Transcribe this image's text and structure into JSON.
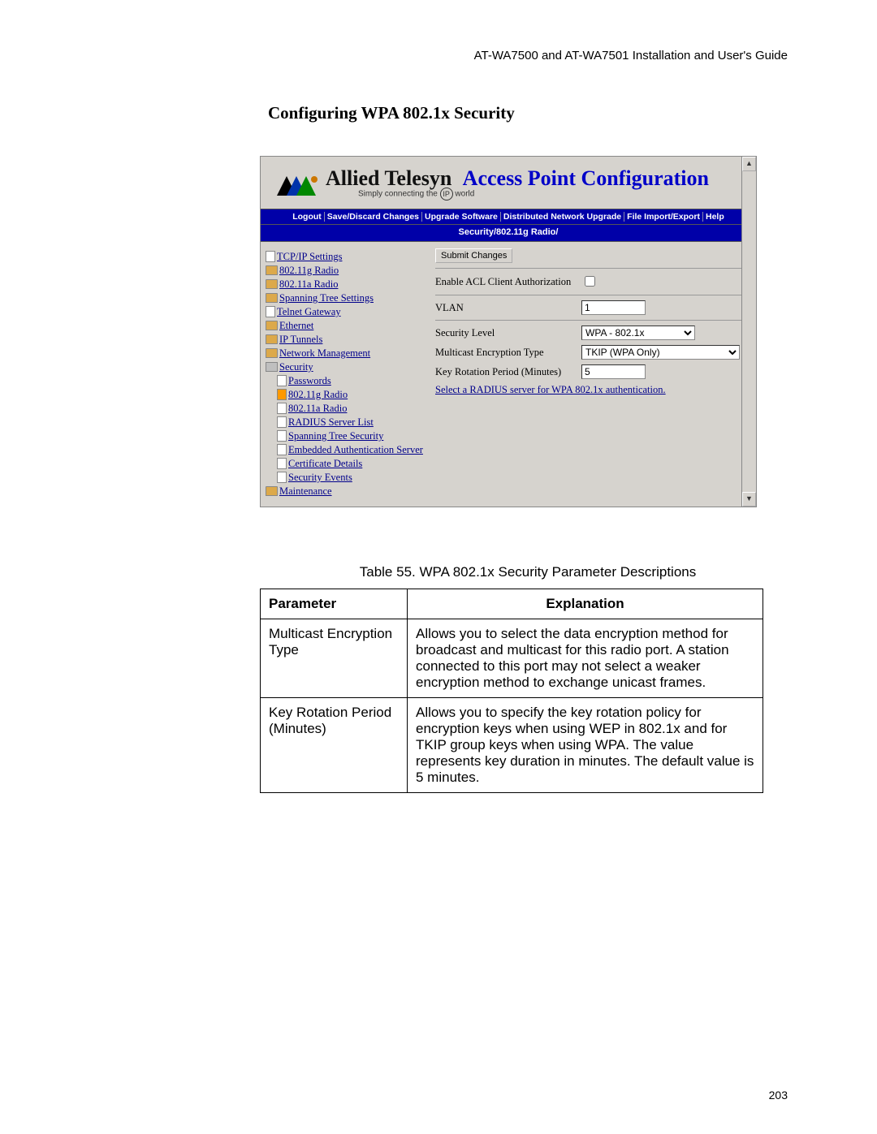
{
  "doc_header": "AT-WA7500 and AT-WA7501 Installation and User's Guide",
  "section_title": "Configuring WPA 802.1x Security",
  "page_number": "203",
  "screenshot": {
    "brand_left": "Allied Telesyn",
    "brand_right": "Access Point Configuration",
    "brand_sub_pre": "Simply connecting the",
    "brand_sub_ip": "IP",
    "brand_sub_post": "world",
    "menu": [
      "Logout",
      "Save/Discard Changes",
      "Upgrade Software",
      "Distributed Network Upgrade",
      "File Import/Export",
      "Help"
    ],
    "breadcrumb": "Security/802.11g Radio/",
    "nav": [
      {
        "icon": "icon-page",
        "label": "TCP/IP Settings",
        "indent": 0
      },
      {
        "icon": "icon-folder",
        "label": "802.11g Radio",
        "indent": 0
      },
      {
        "icon": "icon-folder",
        "label": "802.11a Radio",
        "indent": 0
      },
      {
        "icon": "icon-folder",
        "label": "Spanning Tree Settings",
        "indent": 0
      },
      {
        "icon": "icon-page",
        "label": "Telnet Gateway",
        "indent": 0
      },
      {
        "icon": "icon-folder",
        "label": "Ethernet",
        "indent": 0
      },
      {
        "icon": "icon-folder",
        "label": "IP Tunnels",
        "indent": 0
      },
      {
        "icon": "icon-folder",
        "label": "Network Management",
        "indent": 0
      },
      {
        "icon": "icon-folder-open",
        "label": "Security",
        "indent": 0
      },
      {
        "icon": "icon-page",
        "label": "Passwords",
        "indent": 1
      },
      {
        "icon": "icon-page orange",
        "label": "802.11g Radio",
        "indent": 1
      },
      {
        "icon": "icon-page",
        "label": "802.11a Radio",
        "indent": 1
      },
      {
        "icon": "icon-page",
        "label": "RADIUS Server List",
        "indent": 1
      },
      {
        "icon": "icon-page",
        "label": "Spanning Tree Security",
        "indent": 1
      },
      {
        "icon": "icon-page",
        "label": "Embedded Authentication Server",
        "indent": 1
      },
      {
        "icon": "icon-page",
        "label": "Certificate Details",
        "indent": 1
      },
      {
        "icon": "icon-page",
        "label": "Security Events",
        "indent": 1
      },
      {
        "icon": "icon-folder",
        "label": "Maintenance",
        "indent": 0
      }
    ],
    "submit_label": "Submit Changes",
    "fields": {
      "acl_label": "Enable ACL Client Authorization",
      "vlan_label": "VLAN",
      "vlan_value": "1",
      "seclevel_label": "Security Level",
      "seclevel_value": "WPA - 802.1x",
      "mcast_label": "Multicast Encryption Type",
      "mcast_value": "TKIP (WPA Only)",
      "rotation_label": "Key Rotation Period (Minutes)",
      "rotation_value": "5",
      "radius_link": "Select a RADIUS server for WPA 802.1x authentication."
    }
  },
  "table": {
    "caption": "Table 55. WPA 802.1x Security Parameter Descriptions",
    "head_param": "Parameter",
    "head_expl": "Explanation",
    "rows": [
      {
        "param": "Multicast Encryption Type",
        "expl": "Allows you to select the data encryption method for broadcast and multicast for this radio port. A station connected to this port may not select a weaker encryption method to exchange unicast frames."
      },
      {
        "param": "Key Rotation Period (Minutes)",
        "expl": "Allows you to specify the key rotation policy for encryption keys when using WEP in 802.1x and for TKIP group keys when using WPA. The value represents key duration in minutes. The default value is 5 minutes."
      }
    ]
  }
}
